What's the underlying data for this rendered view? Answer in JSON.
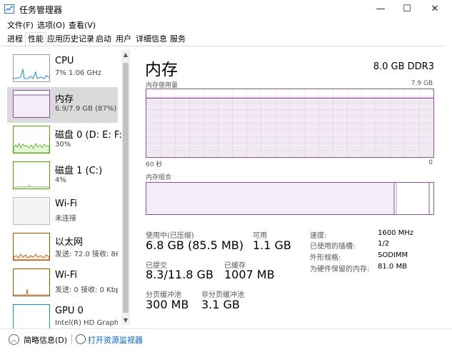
{
  "window": {
    "title": "任务管理器",
    "minimize": "—",
    "maximize": "☐",
    "close": "✕"
  },
  "menu": [
    "文件(F)",
    "选项(O)",
    "查看(V)"
  ],
  "tabs": [
    "进程",
    "性能",
    "应用历史记录",
    "启动",
    "用户",
    "详细信息",
    "服务"
  ],
  "active_tab": "性能",
  "sidebar": {
    "items": [
      {
        "name": "CPU",
        "detail": "7% 1.06 GHz",
        "color": "#1a8ad4"
      },
      {
        "name": "内存",
        "detail": "6.9/7.9 GB (87%)",
        "color": "#8b4f9e"
      },
      {
        "name": "磁盘 0 (D: E: F:",
        "detail": "30%",
        "color": "#4da60c"
      },
      {
        "name": "磁盘 1 (C:)",
        "detail": "4%",
        "color": "#4da60c"
      },
      {
        "name": "Wi-Fi",
        "detail": "未连接",
        "color": "#a74f01"
      },
      {
        "name": "以太网",
        "detail": "发送: 72.0 接收: 864",
        "color": "#a74f01"
      },
      {
        "name": "Wi-Fi",
        "detail": "发送: 0 接收: 0 Kbps",
        "color": "#a74f01"
      },
      {
        "name": "GPU 0",
        "detail": "Intel(R) HD Graphics",
        "color": "#1a8ad4"
      }
    ],
    "selected_index": 1
  },
  "main": {
    "title": "内存",
    "spec": "8.0 GB DDR3",
    "usage_label": "内存使用量",
    "usage_max": "7.9 GB",
    "time_left": "60 秒",
    "time_right": "0",
    "composition_label": "内存组合",
    "usage_fraction": 0.87,
    "stats": {
      "in_use_label": "使用中(已压缩)",
      "in_use_value": "6.8 GB (85.5 MB)",
      "available_label": "可用",
      "available_value": "1.1 GB",
      "committed_label": "已提交",
      "committed_value": "8.3/11.8 GB",
      "cached_label": "已缓存",
      "cached_value": "1007 MB",
      "paged_label": "分页缓冲池",
      "paged_value": "300 MB",
      "nonpaged_label": "非分页缓冲池",
      "nonpaged_value": "3.1 GB"
    },
    "specs": [
      {
        "key": "速度:",
        "value": "1600 MHz"
      },
      {
        "key": "已使用的插槽:",
        "value": "1/2"
      },
      {
        "key": "外形规格:",
        "value": "SODIMM"
      },
      {
        "key": "为硬件保留的内存:",
        "value": "81.0 MB"
      }
    ]
  },
  "footer": {
    "fewer_details": "简略信息(D)",
    "open_resmon": "打开资源监视器"
  },
  "accent_color": "#8b4f9e"
}
